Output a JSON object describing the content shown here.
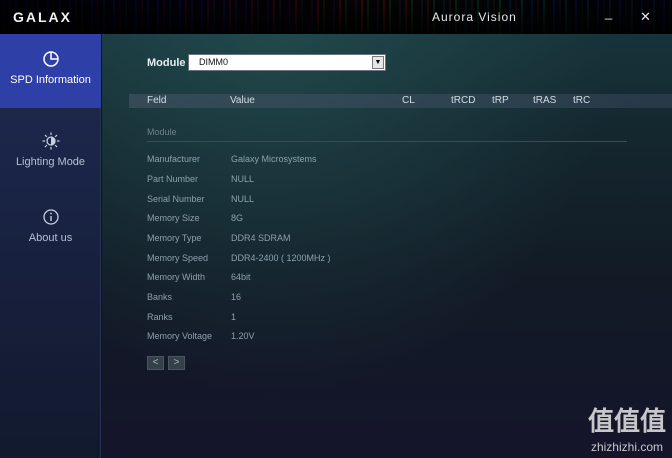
{
  "titlebar": {
    "brand": "GALAX",
    "app_name": "Aurora Vision",
    "minimize_glyph": "_",
    "close_glyph": "✕"
  },
  "sidebar": {
    "items": [
      {
        "label": "SPD Information",
        "icon": "pie-chart-icon",
        "active": true
      },
      {
        "label": "Lighting Mode",
        "icon": "sun-icon",
        "active": false
      },
      {
        "label": "About us",
        "icon": "info-icon",
        "active": false
      }
    ]
  },
  "module_select": {
    "label": "Module",
    "value": "DIMM0",
    "arrow": "▼"
  },
  "table_header": [
    "Feld",
    "Value",
    "CL",
    "tRCD",
    "tRP",
    "tRAS",
    "tRC"
  ],
  "section_title": "Module",
  "info_rows": [
    {
      "key": "Manufacturer",
      "value": "Galaxy Microsystems"
    },
    {
      "key": "Part Number",
      "value": "NULL"
    },
    {
      "key": "Serial Number",
      "value": "NULL"
    },
    {
      "key": "Memory Size",
      "value": "8G"
    },
    {
      "key": "Memory Type",
      "value": "DDR4 SDRAM"
    },
    {
      "key": "Memory Speed",
      "value": "DDR4-2400 ( 1200MHz )"
    },
    {
      "key": "Memory Width",
      "value": "64bit"
    },
    {
      "key": "Banks",
      "value": "16"
    },
    {
      "key": "Ranks",
      "value": "1"
    },
    {
      "key": "Memory Voltage",
      "value": "1.20V"
    }
  ],
  "pager": {
    "prev": "<",
    "next": ">"
  },
  "watermark": {
    "logo": "值值值",
    "url": "zhizhizhi.com"
  },
  "colors": {
    "active_nav": "#2f3fa8",
    "sidebar": "#1a2548"
  }
}
